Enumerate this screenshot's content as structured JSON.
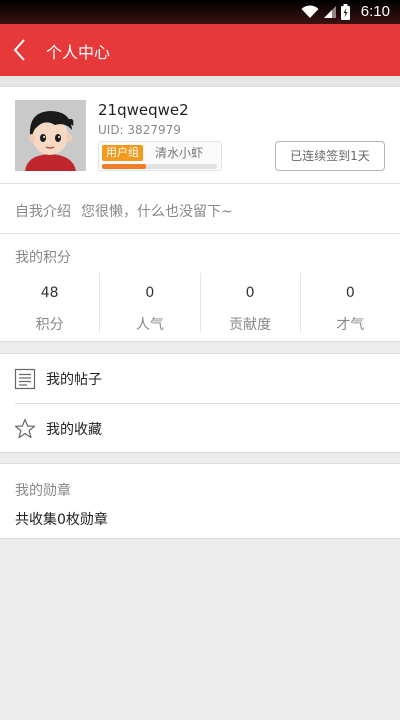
{
  "status_bar": {
    "time": "6:10"
  },
  "app_bar": {
    "title": "个人中心"
  },
  "profile": {
    "username": "21qweqwe2",
    "uid": "UID: 3827979",
    "group_tag": "用户组",
    "group_name": "清水小虾",
    "level_progress": 0.38,
    "checkin_label": "已连续签到1天"
  },
  "intro": {
    "label": "自我介绍",
    "value": "您很懒，什么也没留下~"
  },
  "points": {
    "title": "我的积分",
    "items": [
      {
        "value": "48",
        "label": "积分"
      },
      {
        "value": "0",
        "label": "人气"
      },
      {
        "value": "0",
        "label": "贡献度"
      },
      {
        "value": "0",
        "label": "才气"
      }
    ]
  },
  "menu": [
    {
      "label": "我的帖子",
      "icon": "document-icon"
    },
    {
      "label": "我的收藏",
      "icon": "star-icon"
    }
  ],
  "medals": {
    "title": "我的勋章",
    "count_text": "共收集0枚勋章"
  },
  "colors": {
    "accent": "#e8393a",
    "tag": "#f19a1d",
    "progress": "#f07d2b"
  }
}
